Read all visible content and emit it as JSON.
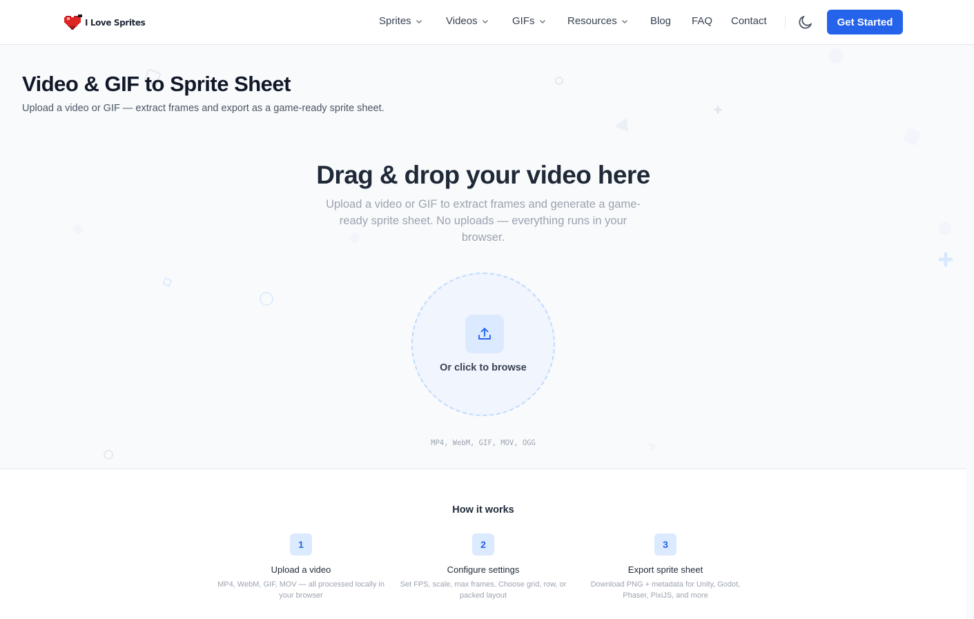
{
  "brand": {
    "name": "I Love Sprites"
  },
  "nav": {
    "items": [
      {
        "label": "Sprites",
        "dropdown": true
      },
      {
        "label": "Videos",
        "dropdown": true
      },
      {
        "label": "GIFs",
        "dropdown": true
      },
      {
        "label": "Resources",
        "dropdown": true
      },
      {
        "label": "Blog",
        "dropdown": false
      },
      {
        "label": "FAQ",
        "dropdown": false
      },
      {
        "label": "Contact",
        "dropdown": false
      }
    ],
    "theme_icon": "moon-icon",
    "cta_label": "Get Started"
  },
  "page": {
    "title": "Video & GIF to Sprite Sheet",
    "subtitle": "Upload a video or GIF — extract frames and export as a game-ready sprite sheet."
  },
  "dropzone": {
    "heading": "Drag & drop your video here",
    "description": "Upload a video or GIF to extract frames and generate a game-ready sprite sheet. No uploads — everything runs in your browser.",
    "browse_label": "Or click to browse",
    "upload_icon": "upload-icon",
    "formats": "MP4, WebM, GIF, MOV, OGG"
  },
  "how": {
    "title": "How it works",
    "steps": [
      {
        "num": "1",
        "title": "Upload a video",
        "desc": "MP4, WebM, GIF, MOV — all processed locally in your browser"
      },
      {
        "num": "2",
        "title": "Configure settings",
        "desc": "Set FPS, scale, max frames. Choose grid, row, or packed layout"
      },
      {
        "num": "3",
        "title": "Export sprite sheet",
        "desc": "Download PNG + metadata for Unity, Godot, Phaser, PixiJS, and more"
      }
    ]
  },
  "colors": {
    "accent": "#2563eb",
    "accent_light": "#dbeafe",
    "background": "#f8fafc",
    "heart": "#dc2626"
  }
}
